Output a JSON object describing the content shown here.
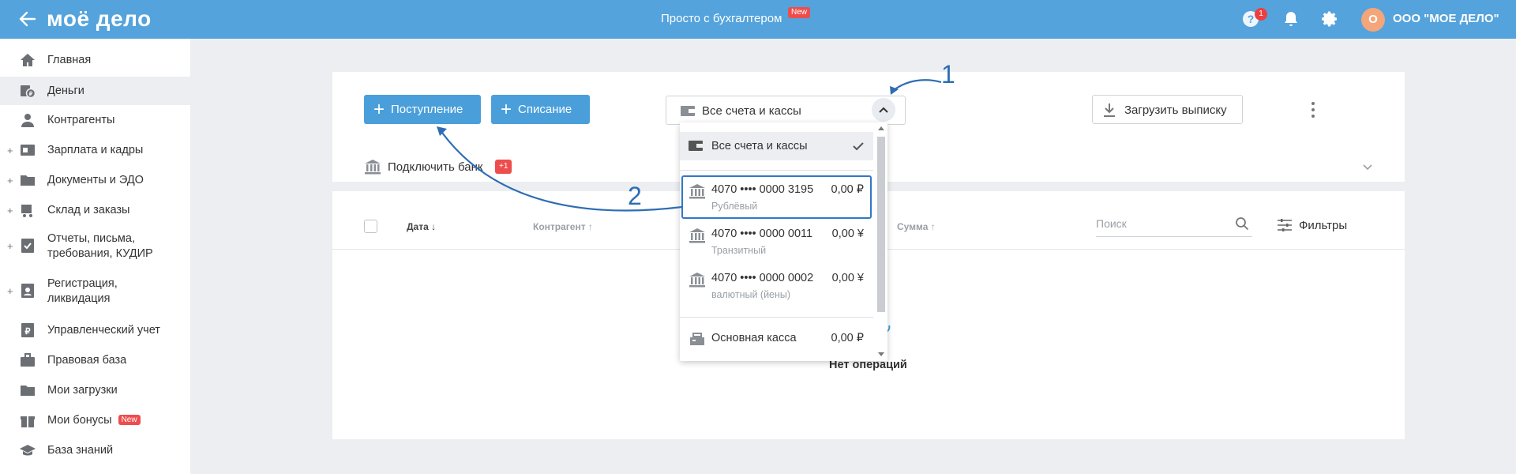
{
  "header": {
    "logo": "моё дело",
    "promo": "Просто с бухгалтером",
    "promo_badge": "New",
    "help_badge": "1",
    "avatar_initial": "О",
    "company": "ООО \"МОЕ ДЕЛО\""
  },
  "sidebar": {
    "items": [
      {
        "label": "Главная",
        "icon": "home-icon",
        "expandable": false,
        "active": false
      },
      {
        "label": "Деньги",
        "icon": "money-icon",
        "expandable": false,
        "active": true
      },
      {
        "label": "Контрагенты",
        "icon": "contractors-icon",
        "expandable": false,
        "active": false
      },
      {
        "label": "Зарплата и кадры",
        "icon": "salary-icon",
        "expandable": true,
        "active": false
      },
      {
        "label": "Документы и ЭДО",
        "icon": "folder-icon",
        "expandable": true,
        "active": false
      },
      {
        "label": "Склад и заказы",
        "icon": "warehouse-icon",
        "expandable": true,
        "active": false
      },
      {
        "label": "Отчеты, письма,",
        "label2": "требования, КУДИР",
        "icon": "reports-icon",
        "expandable": true,
        "active": false
      },
      {
        "label": "Регистрация,",
        "label2": "ликвидация",
        "icon": "registration-icon",
        "expandable": true,
        "active": false
      },
      {
        "label": "Управленческий учет",
        "icon": "management-icon",
        "expandable": false,
        "active": false
      },
      {
        "label": "Правовая база",
        "icon": "briefcase-icon",
        "expandable": false,
        "active": false
      },
      {
        "label": "Мои загрузки",
        "icon": "downloads-folder-icon",
        "expandable": false,
        "active": false
      },
      {
        "label": "Мои бонусы",
        "icon": "gift-icon",
        "expandable": false,
        "active": false,
        "badge": "New"
      },
      {
        "label": "База знаний",
        "icon": "graduation-cap-icon",
        "expandable": false,
        "active": false
      }
    ]
  },
  "toolbar": {
    "income_label": "Поступление",
    "expense_label": "Списание",
    "account_select": "Все счета и кассы",
    "upload_label": "Загрузить выписку"
  },
  "bank": {
    "connect_label": "Подключить банк",
    "badge": "+1"
  },
  "table": {
    "columns": [
      {
        "label": "Дата ↓",
        "style": "bold"
      },
      {
        "label": "Контрагент ↑",
        "style": "muted"
      },
      {
        "label": "Сумма ↑",
        "style": "muted"
      }
    ],
    "search_placeholder": "Поиск",
    "filters_label": "Фильтры",
    "empty_text": "Нет операций"
  },
  "dropdown": {
    "all_label": "Все счета и кассы",
    "accounts": [
      {
        "number": "4070 •••• 0000 3195",
        "amount": "0,00 ₽",
        "type": "Рублёвый",
        "selected": true
      },
      {
        "number": "4070 •••• 0000 0011",
        "amount": "0,00 ¥",
        "type": "Транзитный",
        "selected": false
      },
      {
        "number": "4070 •••• 0000 0002",
        "amount": "0,00 ¥",
        "type": "валютный (йены)",
        "selected": false
      }
    ],
    "cash": {
      "label": "Основная касса",
      "amount": "0,00 ₽"
    }
  },
  "annotations": {
    "one": "1",
    "two": "2"
  },
  "colors": {
    "header": "#54a3dc",
    "primary_button": "#4a9fdb",
    "badge": "#ee4d4d",
    "annotation": "#2e6db4"
  }
}
